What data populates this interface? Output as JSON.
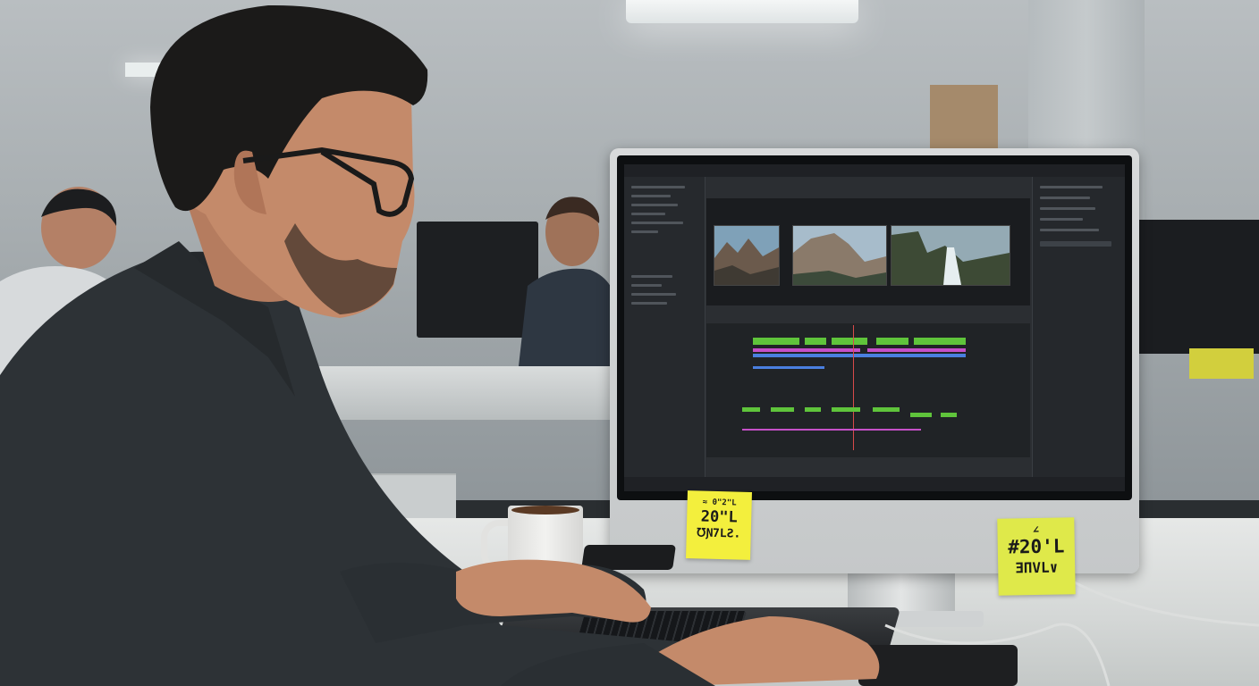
{
  "scene": {
    "description_colors": {
      "wall": "#a9afb2",
      "desk": "#e6e8e7",
      "shirt": "#2d3236",
      "skin": "#c48a6a",
      "sticky_yellow": "#f3ef3d",
      "clip_green": "#5fc43b",
      "clip_magenta": "#c550c8",
      "clip_blue": "#4a7fe0"
    }
  },
  "sticky_notes": [
    {
      "line1": "≈ 0\"2\"L",
      "line2": "20\"L",
      "line3": "℧Ɲ7LƧ."
    },
    {
      "line1": "∠",
      "line2": "#20'L",
      "line3": "ƎΠVL∨"
    }
  ],
  "icons": [
    "monitor-icon",
    "coffee-cup-icon",
    "keyboard-icon",
    "phone-icon"
  ]
}
